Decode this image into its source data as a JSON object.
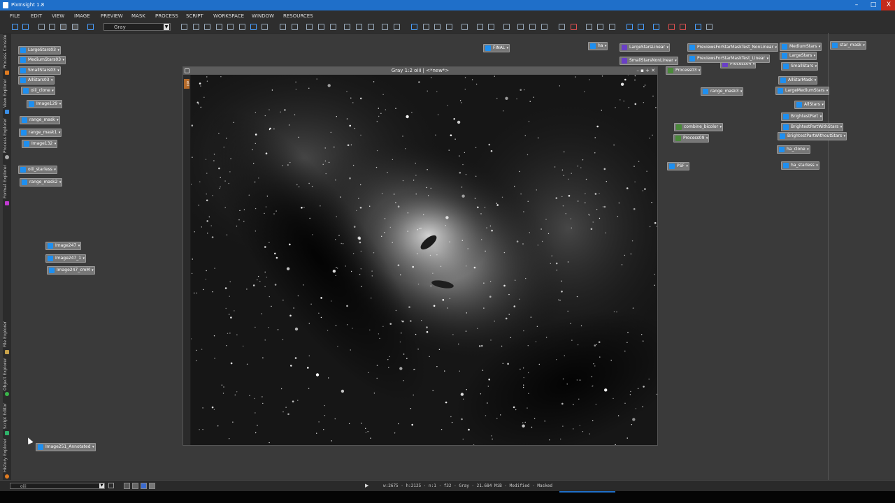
{
  "app": {
    "title": "PixInsight 1.8",
    "window_buttons": {
      "minimize": "–",
      "maximize": "□",
      "close": "X"
    }
  },
  "menu": [
    "FILE",
    "EDIT",
    "VIEW",
    "IMAGE",
    "PREVIEW",
    "MASK",
    "PROCESS",
    "SCRIPT",
    "WORKSPACE",
    "WINDOW",
    "RESOURCES"
  ],
  "toolbar": {
    "view_select": "Gray"
  },
  "sidebar_tabs": [
    "Process Console",
    "View Explorer",
    "Process Explorer",
    "Format Explorer",
    "File Explorer",
    "Object Explorer",
    "Script Editor",
    "History Explorer"
  ],
  "image_window": {
    "title": "Gray 1:2 oiii | <*new*>",
    "side_tag": "oiii",
    "controls": "– ▪ + ✕"
  },
  "left_icons": [
    {
      "label": "LargeStars03",
      "type": "image"
    },
    {
      "label": "MediumStars03",
      "type": "image"
    },
    {
      "label": "SmallStars03",
      "type": "image"
    },
    {
      "label": "AllStars03",
      "type": "image"
    },
    {
      "label": "oiii_clone",
      "type": "image"
    },
    {
      "label": "Image129",
      "type": "image"
    },
    {
      "label": "range_mask",
      "type": "image"
    },
    {
      "label": "range_mask1",
      "type": "image"
    },
    {
      "label": "Image132",
      "type": "image"
    },
    {
      "label": "oiii_starless",
      "type": "image"
    },
    {
      "label": "range_mask2",
      "type": "image"
    },
    {
      "label": "Image247",
      "type": "image"
    },
    {
      "label": "Image247_1",
      "type": "image"
    },
    {
      "label": "Image247_cmM",
      "type": "image"
    },
    {
      "label": "Image251_Annotated",
      "type": "image"
    }
  ],
  "right_icons": [
    {
      "label": "FINAL",
      "type": "image"
    },
    {
      "label": "ha",
      "type": "image"
    },
    {
      "label": "LargeStarsLinear",
      "type": "process"
    },
    {
      "label": "SmallStarsNonLinear",
      "type": "process"
    },
    {
      "label": "Process04",
      "type": "process"
    },
    {
      "label": "Process03",
      "type": "process"
    },
    {
      "label": "PreviewsForStarMaskTest_NonLinear",
      "type": "image"
    },
    {
      "label": "PreviewsForStarMaskTest_Linear",
      "type": "image"
    },
    {
      "label": "range_mask3",
      "type": "image"
    },
    {
      "label": "combine_bicolor",
      "type": "process2"
    },
    {
      "label": "Process09",
      "type": "process2"
    },
    {
      "label": "PSF",
      "type": "image"
    },
    {
      "label": "MediumStars",
      "type": "image"
    },
    {
      "label": "LargeStars",
      "type": "image"
    },
    {
      "label": "SmallStars",
      "type": "image"
    },
    {
      "label": "AllStarMask",
      "type": "image"
    },
    {
      "label": "LargeMediumStars",
      "type": "image"
    },
    {
      "label": "AllStars",
      "type": "image"
    },
    {
      "label": "BrightestPart",
      "type": "image"
    },
    {
      "label": "BrightestPartWithStars",
      "type": "image"
    },
    {
      "label": "BrightestPartWithoutStars",
      "type": "image"
    },
    {
      "label": "ha_clone",
      "type": "image"
    },
    {
      "label": "ha_starless",
      "type": "image"
    },
    {
      "label": "star_mask",
      "type": "image"
    }
  ],
  "statusbar": {
    "view": "oiii",
    "play": "▶",
    "info": "w:2675 · h:2125 · n:1 · f32 · Gray · 21.684 MiB · Modified · Masked"
  },
  "colors": {
    "titlebar": "#1f6fc9",
    "image_icon": "#1e8ff0",
    "process_icon": "#6a3fc7"
  }
}
